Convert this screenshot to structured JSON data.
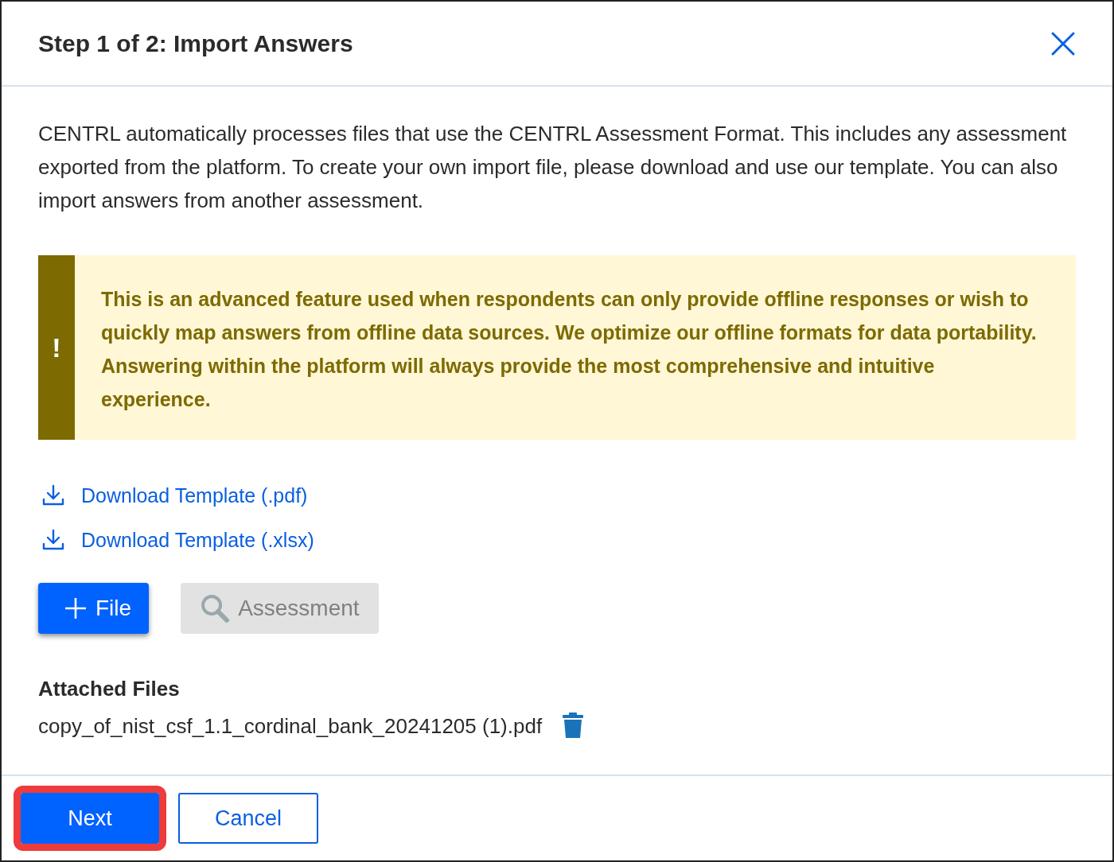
{
  "dialog": {
    "title": "Step 1 of 2: Import Answers"
  },
  "intro": "CENTRL automatically processes files that use the CENTRL Assessment Format. This includes any assessment exported from the platform. To create your own import file, please download and use our template. You can also import answers from another assessment.",
  "warning": {
    "icon": "!",
    "text": "This is an advanced feature used when respondents can only provide offline responses or wish to quickly map answers from offline data sources. We optimize our offline formats for data portability. Answering within the platform will always provide the most comprehensive and intuitive experience."
  },
  "downloads": [
    {
      "label": "Download Template (.pdf)"
    },
    {
      "label": "Download Template (.xlsx)"
    }
  ],
  "add_buttons": [
    {
      "kind": "plus",
      "label": "File",
      "disabled": false
    },
    {
      "kind": "search",
      "label": "Assessment",
      "disabled": true
    }
  ],
  "attached_files": {
    "heading": "Attached Files",
    "files": [
      {
        "name": "copy_of_nist_csf_1.1_cordinal_bank_20241205 (1).pdf"
      }
    ]
  },
  "footer_buttons": [
    {
      "kind": "primary",
      "label": "Next",
      "highlighted": true
    },
    {
      "kind": "secondary",
      "label": "Cancel",
      "highlighted": false
    }
  ]
}
